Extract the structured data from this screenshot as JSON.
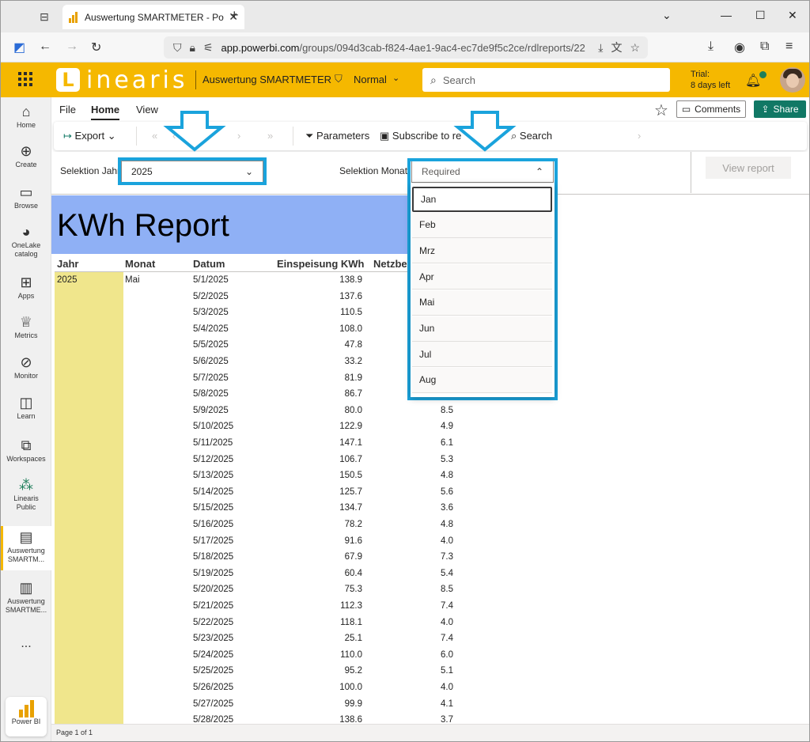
{
  "browser": {
    "tab_title": "Auswertung SMARTMETER - Po",
    "url_domain": "app.powerbi.com",
    "url_path": "/groups/094d3cab-f824-4ae1-9ac4-ec7de9f5c2ce/rdlreports/22"
  },
  "header": {
    "logo_letter": "L",
    "logo_text": "inearis",
    "report_name": "Auswertung SMARTMETER",
    "sensitivity": "Normal",
    "search_placeholder": "Search",
    "trial_line1": "Trial:",
    "trial_line2": "8 days left"
  },
  "rail": {
    "items": [
      {
        "icon": "home-icon",
        "label": "Home"
      },
      {
        "icon": "create-icon",
        "label": "Create"
      },
      {
        "icon": "browse-icon",
        "label": "Browse"
      },
      {
        "icon": "onelake-icon",
        "label": "OneLake catalog"
      },
      {
        "icon": "apps-icon",
        "label": "Apps"
      },
      {
        "icon": "metrics-icon",
        "label": "Metrics"
      },
      {
        "icon": "monitor-icon",
        "label": "Monitor"
      },
      {
        "icon": "learn-icon",
        "label": "Learn"
      },
      {
        "icon": "workspaces-icon",
        "label": "Workspaces"
      },
      {
        "icon": "workspace-group-icon",
        "label": "Linearis Public"
      },
      {
        "icon": "report-icon",
        "label": "Auswertung SMARTM..."
      },
      {
        "icon": "report-chart-icon",
        "label": "Auswertung SMARTME..."
      }
    ],
    "more": "...",
    "app_label": "Power BI"
  },
  "menu": {
    "file": "File",
    "home": "Home",
    "view": "View",
    "comments": "Comments",
    "share": "Share"
  },
  "toolbar": {
    "export": "Export",
    "parameters": "Parameters",
    "subscribe": "Subscribe to re",
    "search": "Search"
  },
  "params": {
    "year_label": "Selektion Jahr",
    "year_value": "2025",
    "month_label": "Selektion Monat",
    "month_placeholder": "Required",
    "view_report": "View report"
  },
  "month_options": [
    "Jan",
    "Feb",
    "Mrz",
    "Apr",
    "Mai",
    "Jun",
    "Jul",
    "Aug"
  ],
  "report": {
    "title": "KWh Report",
    "columns": [
      "Jahr",
      "Monat",
      "Datum",
      "Einspeisung KWh",
      "Netzbe"
    ],
    "year": "2025",
    "month": "Mai",
    "rows": [
      {
        "datum": "5/1/2025",
        "einspeisung": "138.9",
        "netz": ""
      },
      {
        "datum": "5/2/2025",
        "einspeisung": "137.6",
        "netz": ""
      },
      {
        "datum": "5/3/2025",
        "einspeisung": "110.5",
        "netz": ""
      },
      {
        "datum": "5/4/2025",
        "einspeisung": "108.0",
        "netz": ""
      },
      {
        "datum": "5/5/2025",
        "einspeisung": "47.8",
        "netz": ""
      },
      {
        "datum": "5/6/2025",
        "einspeisung": "33.2",
        "netz": ""
      },
      {
        "datum": "5/7/2025",
        "einspeisung": "81.9",
        "netz": ""
      },
      {
        "datum": "5/8/2025",
        "einspeisung": "86.7",
        "netz": ""
      },
      {
        "datum": "5/9/2025",
        "einspeisung": "80.0",
        "netz": "8.5"
      },
      {
        "datum": "5/10/2025",
        "einspeisung": "122.9",
        "netz": "4.9"
      },
      {
        "datum": "5/11/2025",
        "einspeisung": "147.1",
        "netz": "6.1"
      },
      {
        "datum": "5/12/2025",
        "einspeisung": "106.7",
        "netz": "5.3"
      },
      {
        "datum": "5/13/2025",
        "einspeisung": "150.5",
        "netz": "4.8"
      },
      {
        "datum": "5/14/2025",
        "einspeisung": "125.7",
        "netz": "5.6"
      },
      {
        "datum": "5/15/2025",
        "einspeisung": "134.7",
        "netz": "3.6"
      },
      {
        "datum": "5/16/2025",
        "einspeisung": "78.2",
        "netz": "4.8"
      },
      {
        "datum": "5/17/2025",
        "einspeisung": "91.6",
        "netz": "4.0"
      },
      {
        "datum": "5/18/2025",
        "einspeisung": "67.9",
        "netz": "7.3"
      },
      {
        "datum": "5/19/2025",
        "einspeisung": "60.4",
        "netz": "5.4"
      },
      {
        "datum": "5/20/2025",
        "einspeisung": "75.3",
        "netz": "8.5"
      },
      {
        "datum": "5/21/2025",
        "einspeisung": "112.3",
        "netz": "7.4"
      },
      {
        "datum": "5/22/2025",
        "einspeisung": "118.1",
        "netz": "4.0"
      },
      {
        "datum": "5/23/2025",
        "einspeisung": "25.1",
        "netz": "7.4"
      },
      {
        "datum": "5/24/2025",
        "einspeisung": "110.0",
        "netz": "6.0"
      },
      {
        "datum": "5/25/2025",
        "einspeisung": "95.2",
        "netz": "5.1"
      },
      {
        "datum": "5/26/2025",
        "einspeisung": "100.0",
        "netz": "4.0"
      },
      {
        "datum": "5/27/2025",
        "einspeisung": "99.9",
        "netz": "4.1"
      },
      {
        "datum": "5/28/2025",
        "einspeisung": "138.6",
        "netz": "3.7"
      }
    ]
  },
  "status": {
    "page": "Page 1 of 1"
  },
  "colors": {
    "brand_yellow": "#f5b800",
    "highlight_blue": "#1aa3dc",
    "report_title_bg": "#8fb0f5",
    "year_column_bg": "#f0e68c",
    "share_green": "#117865"
  }
}
